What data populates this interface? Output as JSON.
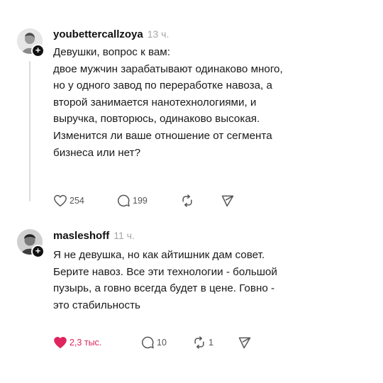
{
  "posts": [
    {
      "username": "youbettercallzoya",
      "time": "13 ч.",
      "avatar_icon": "avatar-photo-icon",
      "lines": [
        "Девушки, вопрос к вам:",
        "двое мужчин зарабатывают одинаково много,",
        "но у одного завод по переработке навоза, а",
        "второй занимается нанотехнологиями, и",
        "выручка, повторюсь, одинаково высокая.",
        "Изменится ли ваше отношение от сегмента",
        "бизнеса или нет?"
      ],
      "actions": {
        "likes": "254",
        "replies": "199",
        "reposts": "",
        "liked": false
      }
    },
    {
      "username": "masleshoff",
      "time": "11 ч.",
      "avatar_icon": "avatar-photo-icon",
      "lines": [
        "Я не девушка, но как айтишник дам совет.",
        "Берите навоз. Все эти технологии - большой",
        "пузырь, а говно всегда будет в цене. Говно -",
        "это стабильность"
      ],
      "actions": {
        "likes": "2,3 тыс.",
        "replies": "10",
        "reposts": "1",
        "liked": true
      }
    }
  ],
  "colors": {
    "liked_heart": "#e0245e",
    "muted": "#a6a6a6",
    "icon": "#555555"
  }
}
